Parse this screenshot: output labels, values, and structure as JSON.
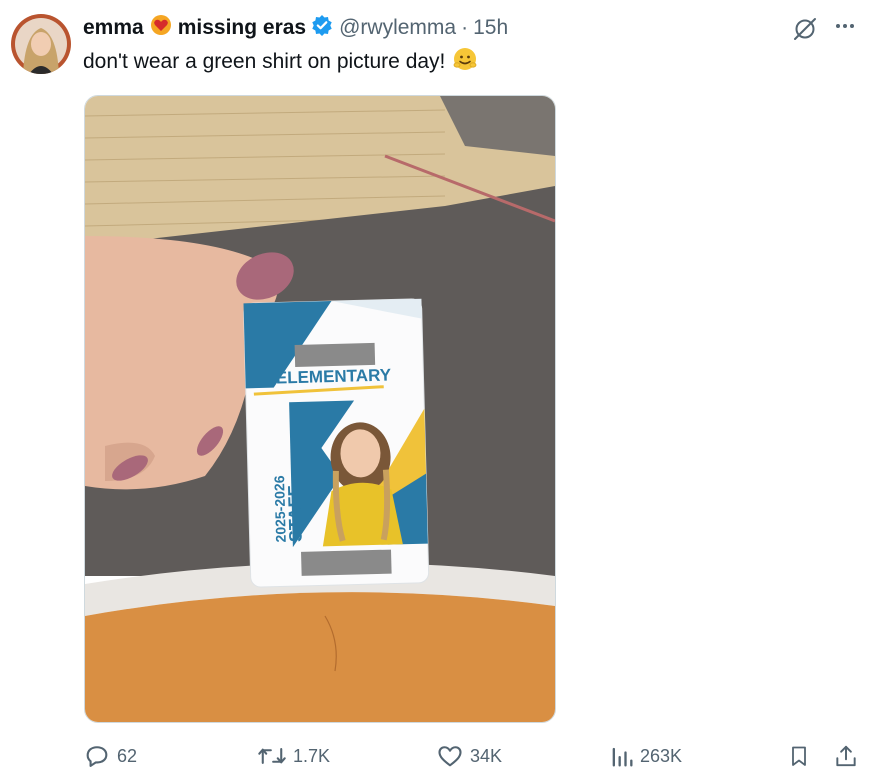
{
  "tweet": {
    "display_name": "emma",
    "display_name_extra": "missing eras",
    "handle": "@rwylemma",
    "separator": "·",
    "time": "15h",
    "text": "don't wear a green shirt on picture day!",
    "verified": true
  },
  "media": {
    "badge_school": "ELEMENTARY",
    "badge_year": "2025-2026",
    "badge_role": "STAFF"
  },
  "actions": {
    "replies": "62",
    "reposts": "1.7K",
    "likes": "34K",
    "views": "263K"
  },
  "colors": {
    "verified": "#1d9bf0",
    "muted": "#536471",
    "badge_blue": "#2a7aa6",
    "badge_yellow": "#f0c23a"
  },
  "icons": [
    "grok-icon",
    "more-icon",
    "reply-icon",
    "retweet-icon",
    "heart-icon",
    "views-icon",
    "bookmark-icon",
    "share-icon",
    "verified-icon",
    "heart-emoji-icon",
    "smile-emoji-icon"
  ]
}
